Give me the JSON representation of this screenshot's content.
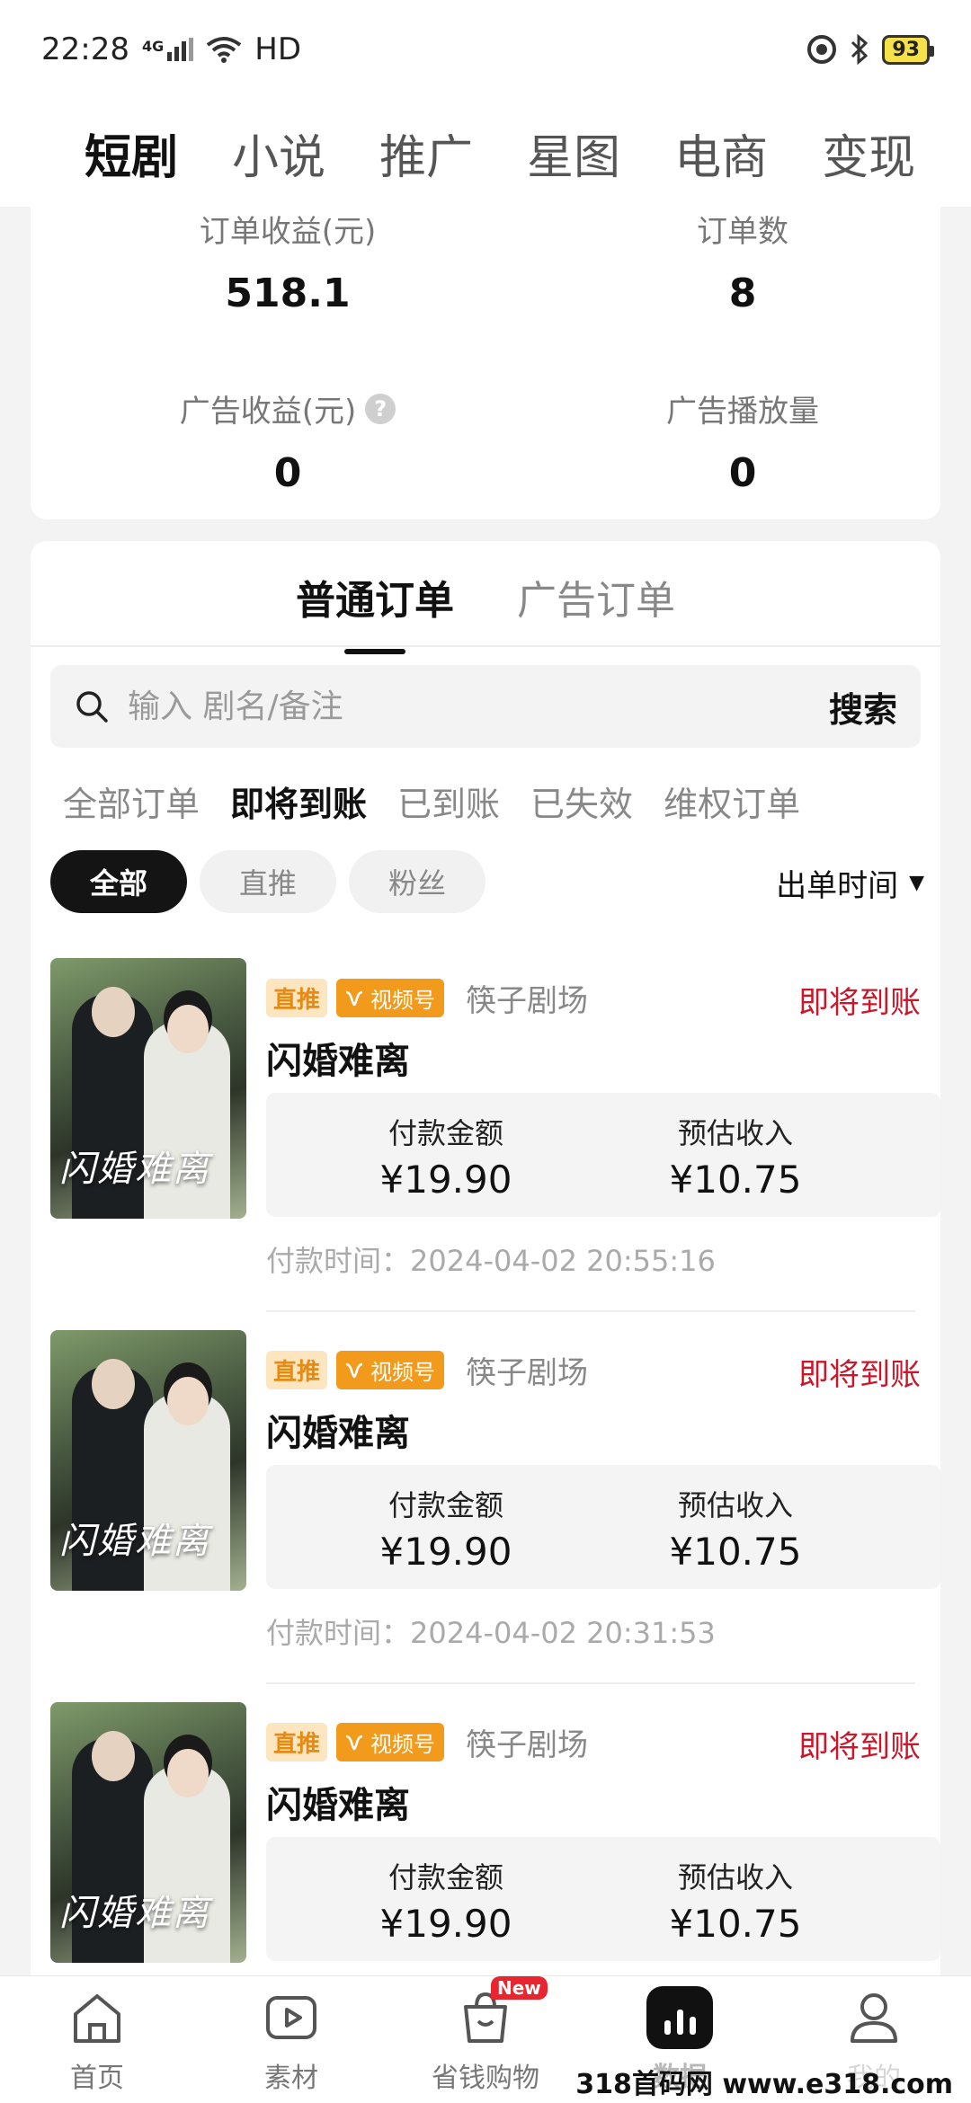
{
  "status_bar": {
    "time": "22:28",
    "network": "4G",
    "hd": "HD",
    "battery": "93"
  },
  "top_tabs": [
    "短剧",
    "小说",
    "推广",
    "星图",
    "电商",
    "变现"
  ],
  "summary": {
    "order_income_label": "订单收益(元)",
    "order_income_value": "518.1",
    "order_count_label": "订单数",
    "order_count_value": "8",
    "ad_income_label": "广告收益(元)",
    "ad_income_value": "0",
    "ad_plays_label": "广告播放量",
    "ad_plays_value": "0",
    "help_glyph": "?"
  },
  "order_tabs": [
    "普通订单",
    "广告订单"
  ],
  "search": {
    "placeholder": "输入 剧名/备注",
    "button": "搜索"
  },
  "status_filters": [
    "全部订单",
    "即将到账",
    "已到账",
    "已失效",
    "维权订单"
  ],
  "chips": [
    "全部",
    "直推",
    "粉丝"
  ],
  "sort": {
    "label": "出单时间",
    "arrow": "▼"
  },
  "orders": [
    {
      "poster_text": "闪婚难离",
      "tag_direct": "直推",
      "tag_channel": "视频号",
      "theater": "筷子剧场",
      "status": "即将到账",
      "title": "闪婚难离",
      "pay_label": "付款金额",
      "pay_value": "¥19.90",
      "income_label": "预估收入",
      "income_value": "¥10.75",
      "pay_time": "付款时间：2024-04-02 20:55:16"
    },
    {
      "poster_text": "闪婚难离",
      "tag_direct": "直推",
      "tag_channel": "视频号",
      "theater": "筷子剧场",
      "status": "即将到账",
      "title": "闪婚难离",
      "pay_label": "付款金额",
      "pay_value": "¥19.90",
      "income_label": "预估收入",
      "income_value": "¥10.75",
      "pay_time": "付款时间：2024-04-02 20:31:53"
    },
    {
      "poster_text": "闪婚难离",
      "tag_direct": "直推",
      "tag_channel": "视频号",
      "theater": "筷子剧场",
      "status": "即将到账",
      "title": "闪婚难离",
      "pay_label": "付款金额",
      "pay_value": "¥19.90",
      "income_label": "预估收入",
      "income_value": "¥10.75",
      "pay_time": ""
    }
  ],
  "bottom_nav": {
    "home": "首页",
    "material": "素材",
    "shopping": "省钱购物",
    "shopping_badge": "New",
    "data": "数据",
    "mine": "我的"
  },
  "watermark": "318首码网 www.e318.com",
  "colors": {
    "accent_red": "#c8182a",
    "tag_orange": "#f29a1c",
    "tag_direct_bg": "#fde6bf"
  }
}
